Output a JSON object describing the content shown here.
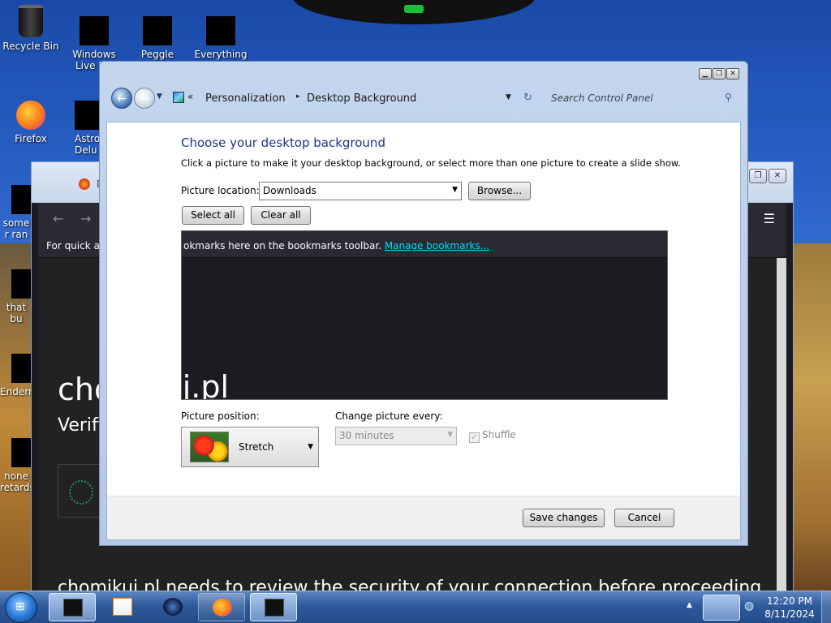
{
  "desktop": {
    "icons": [
      {
        "label": "Recycle Bin"
      },
      {
        "label": "Windows Live Ma"
      },
      {
        "label": "Peggle World"
      },
      {
        "label": "Everything"
      },
      {
        "label": "Firefox"
      },
      {
        "label": "Astro Delu"
      },
      {
        "label": "some r ran"
      },
      {
        "label": "that bu"
      },
      {
        "label": "Enderm"
      },
      {
        "label": "none retards"
      }
    ]
  },
  "browser": {
    "tab_text": "D",
    "bookmarks_prefix": "For quick ac",
    "page_heading": "cho              i.pl",
    "page_subheading": "Verify",
    "bottom_text": "chomikuj.pl needs to review the security of your connection before proceeding."
  },
  "control_panel": {
    "breadcrumb": {
      "overflow": "«",
      "item1": "Personalization",
      "separator": "▸",
      "item2": "Desktop Background"
    },
    "search_placeholder": "Search Control Panel",
    "title": "Choose your desktop background",
    "description": "Click a picture to make it your desktop background, or select more than one picture to create a slide show.",
    "picture_location_label": "Picture location:",
    "picture_location_value": "Downloads",
    "browse_label": "Browse...",
    "select_all_label": "Select all",
    "clear_all_label": "Clear all",
    "gallery_bookmarks_text": "okmarks here on the bookmarks toolbar. ",
    "gallery_bookmarks_link": "Manage bookmarks...",
    "gallery_heading": "chomikuj.pl",
    "picture_position_label": "Picture position:",
    "picture_position_value": "Stretch",
    "change_picture_label": "Change picture every:",
    "change_picture_value": "30 minutes",
    "shuffle_label": "Shuffle",
    "shuffle_checked": true,
    "save_label": "Save changes",
    "cancel_label": "Cancel"
  },
  "taskbar": {
    "time": "12:20 PM",
    "date": "8/11/2024"
  },
  "colors": {
    "title_blue": "#1e3287",
    "link_cyan": "#00ddff",
    "browser_dark": "#1c1b22"
  }
}
